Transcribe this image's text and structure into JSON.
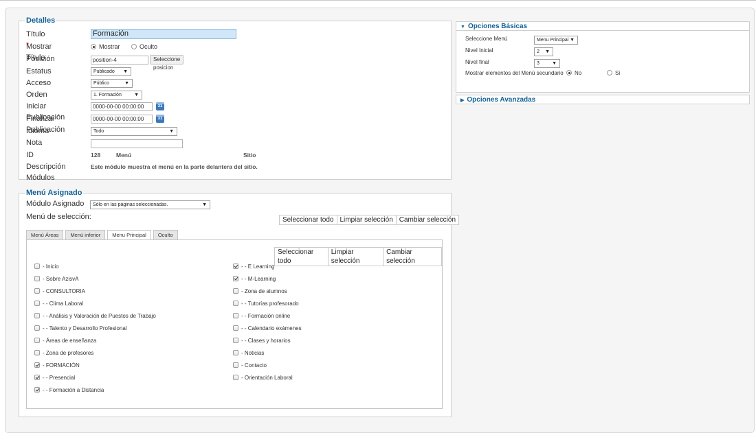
{
  "details": {
    "legend": "Detalles",
    "title_label": "Título",
    "title_req": "*",
    "title_value": "Formación",
    "show_title_label": "Mostrar Título",
    "show_option": "Mostrar",
    "hide_option": "Oculto",
    "position_label": "Posición",
    "position_value": "position-4",
    "position_button": "Seleccione posicion",
    "status_label": "Estatus",
    "status_value": "Publicado",
    "access_label": "Acceso",
    "access_value": "Público",
    "order_label": "Orden",
    "order_value": "1. Formación",
    "start_label": "Iniciar Publicación",
    "start_value": "0000-00-00 00:00:00",
    "end_label": "Finalizar Publicación",
    "end_value": "0000-00-00 00:00:00",
    "calendar_day": "31",
    "language_label": "Idioma",
    "language_value": "Todo",
    "note_label": "Nota",
    "note_value": "",
    "id_label": "ID",
    "id_value": "128",
    "id_menu": "Menú",
    "id_site": "Sitio",
    "desc_label": "Descripción Módulos",
    "desc_value": "Este módulo muestra el menú en la parte delantera del sitio."
  },
  "assigned": {
    "legend": "Menú Asignado",
    "module_label": "Módulo Asignado",
    "module_value": "Sólo en las páginas seleccionadas.",
    "selection_label": "Menú de selección:",
    "select_all": "Seleccionar todo",
    "clear": "Limpiar selección",
    "toggle": "Cambiar selección",
    "tabs": [
      "Menú Áreas",
      "Menú inferior",
      "Menu Principal",
      "Oculto"
    ],
    "left_items": [
      {
        "label": "- Inicio",
        "checked": false
      },
      {
        "label": "- Sobre AzisvA",
        "checked": false
      },
      {
        "label": "- CONSULTORIA",
        "checked": false
      },
      {
        "label": "- - Clima Laboral",
        "checked": false
      },
      {
        "label": "- - Análisis y Valoración de Puestos de Trabajo",
        "checked": false
      },
      {
        "label": "- - Talento y Desarrollo Profesional",
        "checked": false
      },
      {
        "label": "- Áreas de enseñanza",
        "checked": false
      },
      {
        "label": "- Zona de profesores",
        "checked": false
      },
      {
        "label": "- FORMACIÓN",
        "checked": true
      },
      {
        "label": "- - Presencial",
        "checked": true
      },
      {
        "label": "- - Formación a Distancia",
        "checked": true
      }
    ],
    "right_items": [
      {
        "label": "- - E Learning",
        "checked": true
      },
      {
        "label": "- - M-Learning",
        "checked": true
      },
      {
        "label": "- Zona de alumnos",
        "checked": false
      },
      {
        "label": "- - Tutorías profesorado",
        "checked": false
      },
      {
        "label": "- - Formación online",
        "checked": false
      },
      {
        "label": "- - Calendario exámenes",
        "checked": false
      },
      {
        "label": "- - Clases y horarios",
        "checked": false
      },
      {
        "label": "- Noticias",
        "checked": false
      },
      {
        "label": "- Contacto",
        "checked": false
      },
      {
        "label": "- Orientación Laboral",
        "checked": false
      }
    ]
  },
  "basic": {
    "header": "Opciones Básicas",
    "menu_label": "Seleccione Menú",
    "menu_value": "Menu Principal",
    "start_level_label": "Nivel Inicial",
    "start_level_value": "2",
    "end_level_label": "Nivel final",
    "end_level_value": "3",
    "submenu_label": "Mostrar elementos del Menú secundario",
    "no": "No",
    "yes": "Si"
  },
  "advanced": {
    "header": "Opciones Avanzadas"
  }
}
